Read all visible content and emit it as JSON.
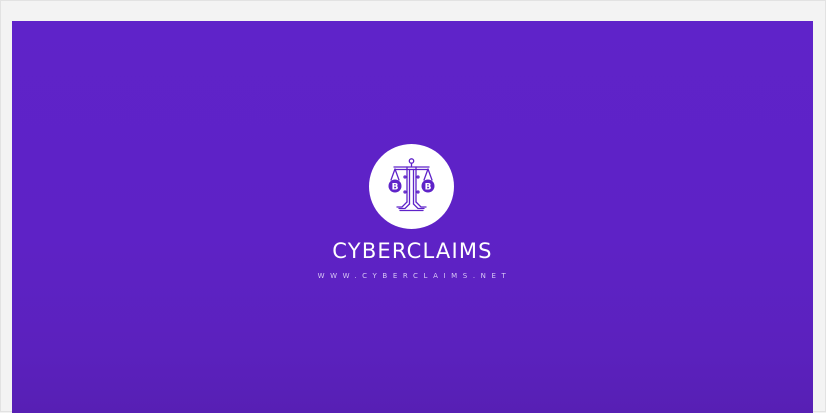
{
  "brand": {
    "name": "CYBERCLAIMS",
    "url": "WWW.CYBERCLAIMS.NET"
  },
  "logo": {
    "icon": "scales-of-justice-bitcoin-icon",
    "background_color": "#ffffff",
    "glyph_color": "#5f23c9",
    "left_coin_symbol": "B",
    "right_coin_symbol": "B"
  },
  "colors": {
    "banner": "#5f23c9",
    "banner_bottom": "#571fb4",
    "page_background": "#f3f3f3",
    "text": "#ffffff"
  }
}
